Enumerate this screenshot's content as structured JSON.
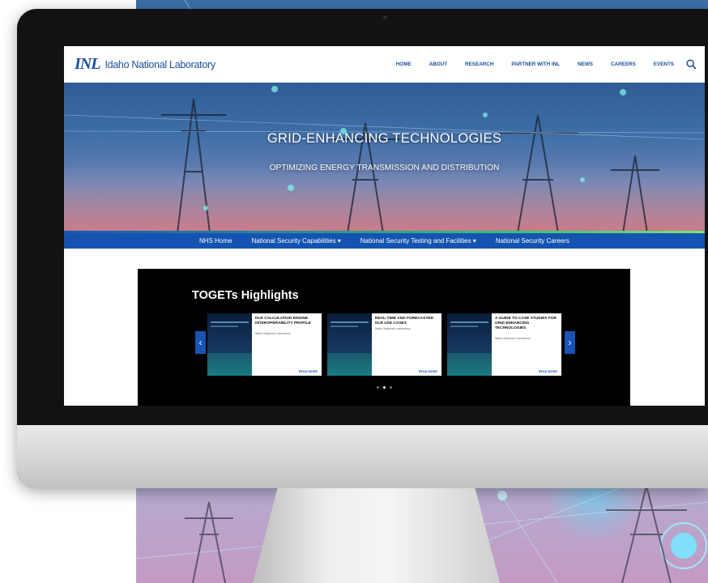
{
  "site": {
    "logo_mark": "INL",
    "logo_name": "Idaho National Laboratory"
  },
  "nav": {
    "items": [
      "HOME",
      "ABOUT",
      "RESEARCH",
      "PARTNER WITH INL",
      "NEWS",
      "CAREERS",
      "EVENTS"
    ],
    "search_icon": "search-icon"
  },
  "hero": {
    "title": "GRID-ENHANCING TECHNOLOGIES",
    "subtitle": "OPTIMIZING ENERGY TRANSMISSION AND DISTRIBUTION"
  },
  "subnav": {
    "items": [
      "NHS Home",
      "National Security Capabilities ▾",
      "National Security Testing and Facilities ▾",
      "National Security Careers"
    ]
  },
  "highlights": {
    "title": "TOGETs Highlights",
    "prev_icon": "chevron-left-icon",
    "next_icon": "chevron-right-icon",
    "cards": [
      {
        "title": "DLR CALCULATION ENGINE INTEROPERABILITY PROFILE",
        "org": "Idaho National Laboratory",
        "more": "READ MORE"
      },
      {
        "title": "REAL-TIME AND FORECASTED DLR USE CASES",
        "org": "Idaho National Laboratory",
        "more": "READ MORE"
      },
      {
        "title": "A GUIDE TO CASE STUDIES FOR GRID ENHANCING TECHNOLOGIES",
        "org": "Idaho National Laboratory",
        "more": "READ MORE"
      }
    ],
    "active_slide": 2
  },
  "colors": {
    "brand_blue": "#1a4d9c",
    "subnav_blue": "#1454b0",
    "arrow_blue": "#1754b4"
  }
}
